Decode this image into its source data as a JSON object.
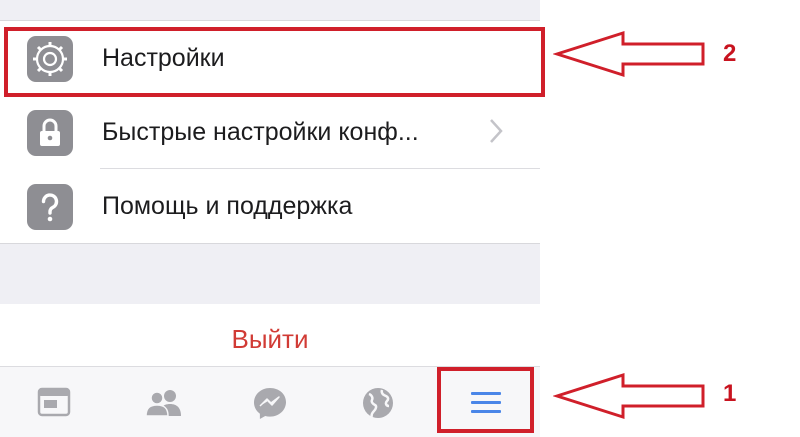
{
  "menu": {
    "items": [
      {
        "label": "Настройки",
        "icon": "gear-icon",
        "chevron": false
      },
      {
        "label": "Быстрые настройки конф...",
        "icon": "lock-icon",
        "chevron": true
      },
      {
        "label": "Помощь и поддержка",
        "icon": "question-icon",
        "chevron": false
      }
    ]
  },
  "logout": {
    "label": "Выйти",
    "color": "#d13b35"
  },
  "tabbar": {
    "tabs": [
      {
        "icon": "news-feed-icon",
        "active": false
      },
      {
        "icon": "friends-icon",
        "active": false
      },
      {
        "icon": "messenger-icon",
        "active": false
      },
      {
        "icon": "globe-icon",
        "active": false
      },
      {
        "icon": "menu-icon",
        "active": true
      }
    ],
    "active_color": "#4a86e8"
  },
  "annotations": {
    "color": "#d01f2a",
    "marker_1": "1",
    "marker_2": "2"
  }
}
